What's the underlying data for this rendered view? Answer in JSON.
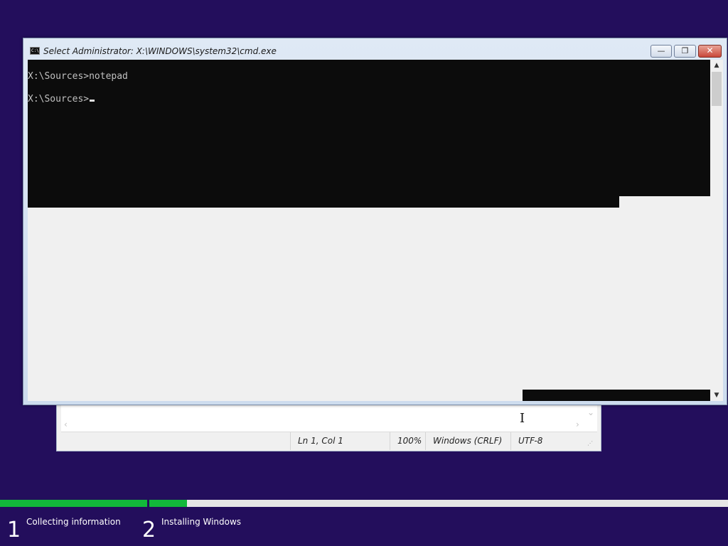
{
  "cmd": {
    "title": "Select Administrator: X:\\WINDOWS\\system32\\cmd.exe",
    "app_icon": "C:\\",
    "lines": [
      "X:\\Sources>notepad",
      "X:\\Sources>"
    ],
    "buttons": {
      "minimize": "—",
      "maximize": "❐",
      "close": "✕"
    },
    "scroll_up": "▲",
    "scroll_down": "▼"
  },
  "notepad": {
    "status": {
      "position": "Ln 1, Col 1",
      "zoom": "100%",
      "line_ending": "Windows (CRLF)",
      "encoding": "UTF-8"
    },
    "arrows": {
      "left": "‹",
      "right": "›",
      "down": "⌄"
    },
    "grip": "⋰"
  },
  "setup": {
    "progress_collecting": 1.0,
    "progress_installing": 0.065,
    "steps": [
      {
        "number": "1",
        "label": "Collecting information"
      },
      {
        "number": "2",
        "label": "Installing Windows"
      }
    ]
  },
  "colors": {
    "desktop": "#230e5c",
    "progress_fill": "#12b83a",
    "console_bg": "#0c0c0c",
    "console_text": "#c0c0c0"
  },
  "icons": {
    "cmd_app": "cmd-app-icon",
    "text_cursor": "ibeam-cursor-icon"
  }
}
